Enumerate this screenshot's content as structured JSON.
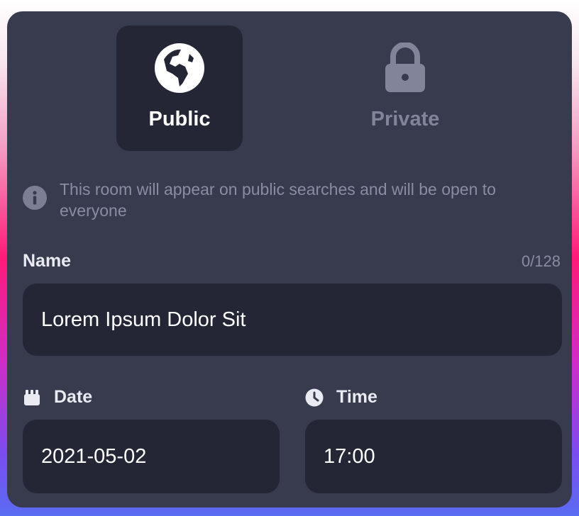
{
  "visibility": {
    "public": {
      "label": "Public",
      "icon": "globe-icon",
      "selected": true
    },
    "private": {
      "label": "Private",
      "icon": "lock-icon",
      "selected": false
    }
  },
  "info": {
    "icon": "info-icon",
    "text": "This room will appear on public searches and will be open to everyone"
  },
  "name": {
    "label": "Name",
    "counter": "0/128",
    "value": "Lorem Ipsum Dolor Sit"
  },
  "date": {
    "label": "Date",
    "icon": "calendar-icon",
    "value": "2021-05-02"
  },
  "time": {
    "label": "Time",
    "icon": "clock-icon",
    "value": "17:00"
  },
  "colors": {
    "card": "#383a4d",
    "field": "#242636",
    "muted": "#8a8ca1",
    "text": "#ffffff"
  }
}
